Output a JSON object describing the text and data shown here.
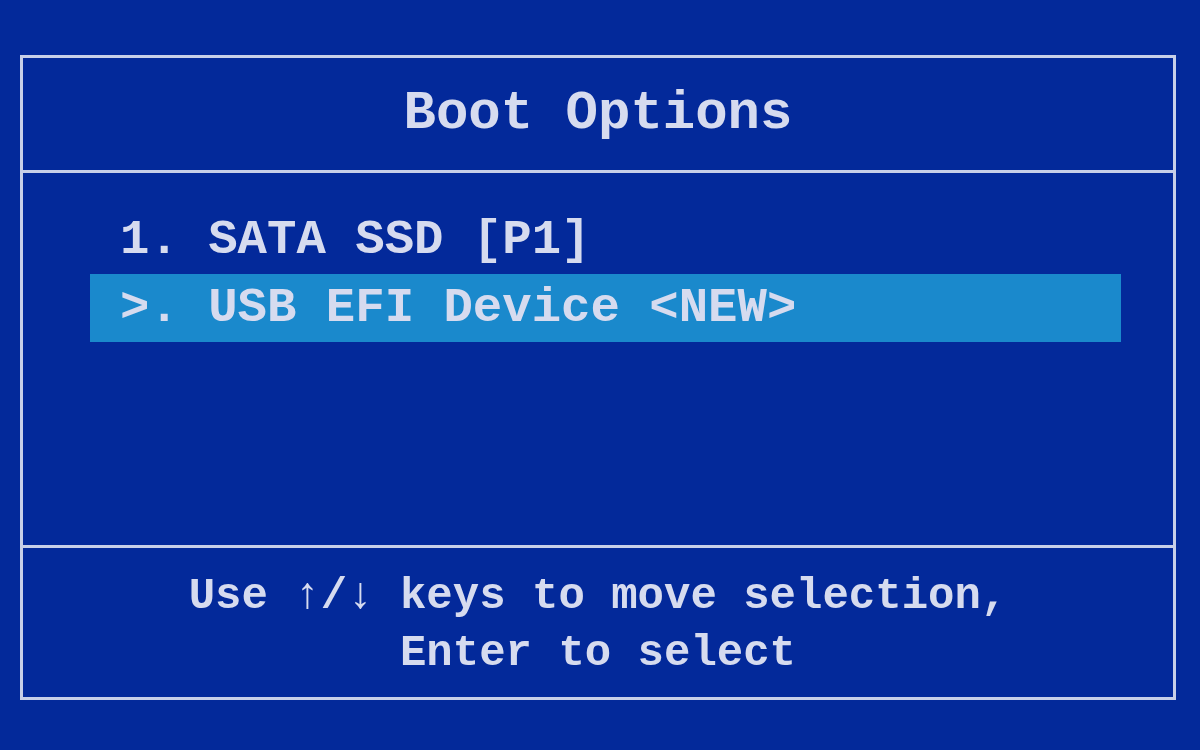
{
  "title": "Boot Options",
  "boot_entries": [
    {
      "label": "1. SATA SSD [P1]",
      "selected": false
    },
    {
      "label": ">. USB EFI Device <NEW>",
      "selected": true
    }
  ],
  "hint_lines": [
    "Use ↑/↓ keys to move selection,",
    "Enter to select"
  ]
}
